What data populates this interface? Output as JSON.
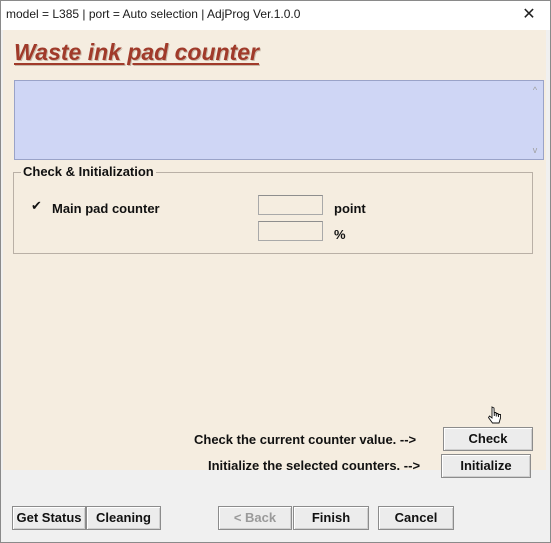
{
  "window": {
    "title": "model = L385 | port = Auto selection | AdjProg Ver.1.0.0",
    "close_glyph": "✕"
  },
  "page": {
    "heading": "Waste ink pad counter"
  },
  "display": {
    "text": "",
    "scroll_up_glyph": "^",
    "scroll_down_glyph": "v"
  },
  "group": {
    "legend": "Check & Initialization",
    "checkbox": {
      "checked": true,
      "glyph": "✔",
      "label": "Main pad counter"
    },
    "point_field": {
      "value": "",
      "unit": "point"
    },
    "percent_field": {
      "value": "",
      "unit": "%"
    }
  },
  "actions": {
    "check_hint": "Check the current counter value. -->",
    "check_label": "Check",
    "init_hint": "Initialize the selected counters. -->",
    "init_label": "Initialize"
  },
  "footer": {
    "get_status": "Get Status",
    "cleaning": "Cleaning",
    "back": "< Back",
    "finish": "Finish",
    "cancel": "Cancel"
  },
  "colors": {
    "panel_background": "#f5ede0",
    "display_background": "#cfd6f5",
    "heading_color": "#a03a2a"
  }
}
